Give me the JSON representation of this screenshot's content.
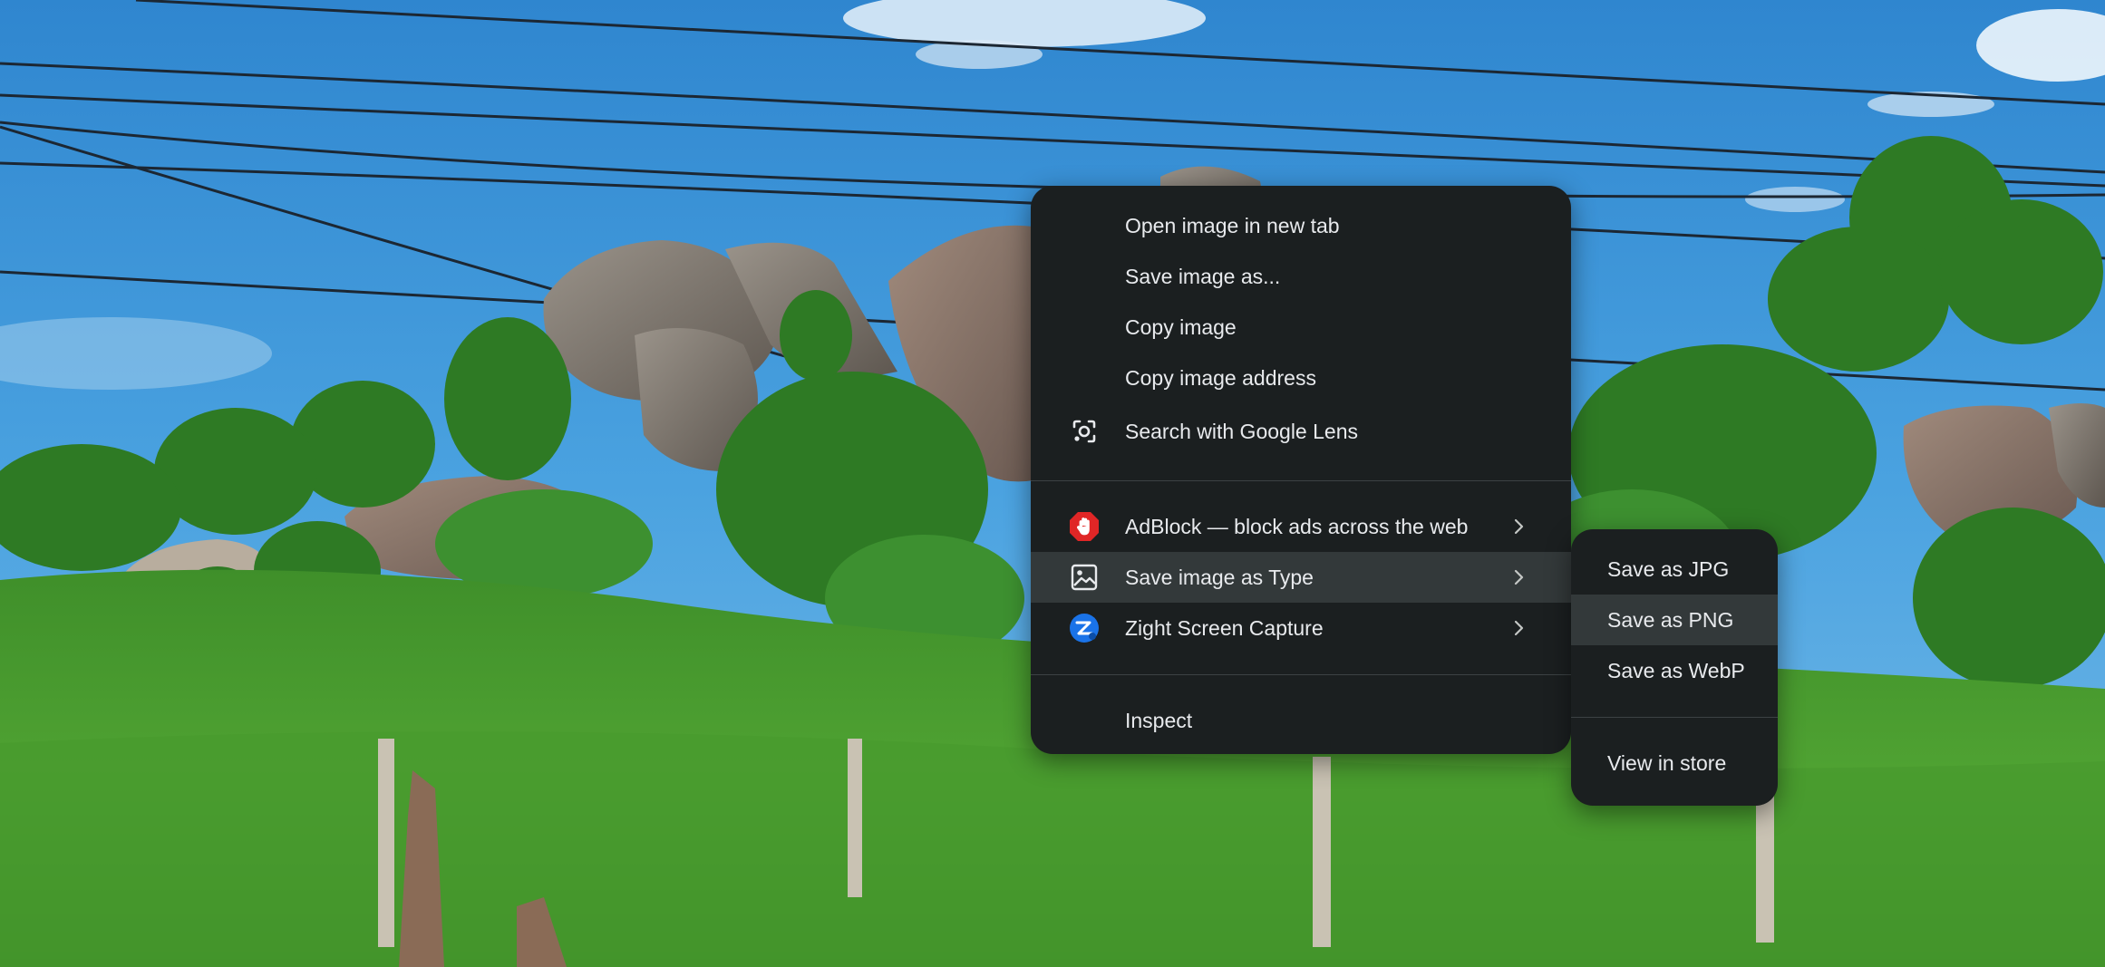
{
  "context_menu": {
    "items": [
      {
        "label": "Open image in new tab"
      },
      {
        "label": "Save image as..."
      },
      {
        "label": "Copy image"
      },
      {
        "label": "Copy image address"
      },
      {
        "label": "Search with Google Lens",
        "icon": "google-lens-icon"
      }
    ],
    "extensions": [
      {
        "label": "AdBlock — block ads across the web",
        "icon": "adblock-hand-icon",
        "has_submenu": true
      },
      {
        "label": "Save image as Type",
        "icon": "image-icon",
        "has_submenu": true,
        "highlighted": true
      },
      {
        "label": "Zight Screen Capture",
        "icon": "zight-icon",
        "has_submenu": true
      }
    ],
    "inspect": {
      "label": "Inspect"
    }
  },
  "submenu": {
    "items": [
      {
        "label": "Save as JPG"
      },
      {
        "label": "Save as PNG",
        "highlighted": true
      },
      {
        "label": "Save as WebP"
      }
    ],
    "store": {
      "label": "View in store"
    }
  },
  "colors": {
    "menu_background": "#1b1f20",
    "menu_highlight": "#33393a",
    "text": "#e8eaed",
    "adblock_red": "#e02626",
    "zight_blue": "#1a73e8"
  }
}
